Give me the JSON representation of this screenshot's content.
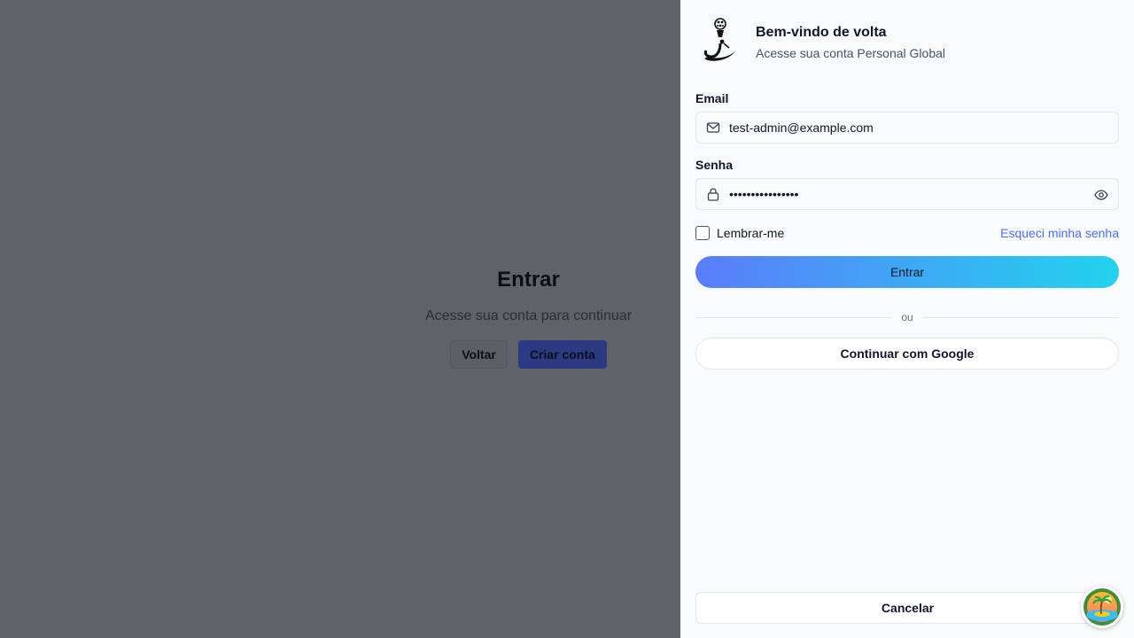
{
  "background": {
    "title": "Entrar",
    "subtitle": "Acesse sua conta para continuar",
    "back_label": "Voltar",
    "create_label": "Criar conta"
  },
  "drawer": {
    "title": "Bem-vindo de volta",
    "subtitle": "Acesse sua conta Personal Global",
    "email": {
      "label": "Email",
      "value": "test-admin@example.com"
    },
    "password": {
      "label": "Senha",
      "masked_value": "••••••••••••••••"
    },
    "remember_label": "Lembrar-me",
    "forgot_label": "Esqueci minha senha",
    "login_label": "Entrar",
    "divider_label": "ou",
    "google_label": "Continuar com Google",
    "cancel_label": "Cancelar"
  },
  "icons": {
    "email": "mail-icon",
    "password": "lock-icon",
    "toggle_visibility": "eye-icon",
    "logo": "brand-logo",
    "fab": "palm-island-icon"
  },
  "colors": {
    "accent_link": "#4f6ef7",
    "gradient_start": "#5b7cfa",
    "gradient_end": "#22d3ee",
    "overlay": "#63646a",
    "primary_bg_button": "#2b3a82"
  }
}
